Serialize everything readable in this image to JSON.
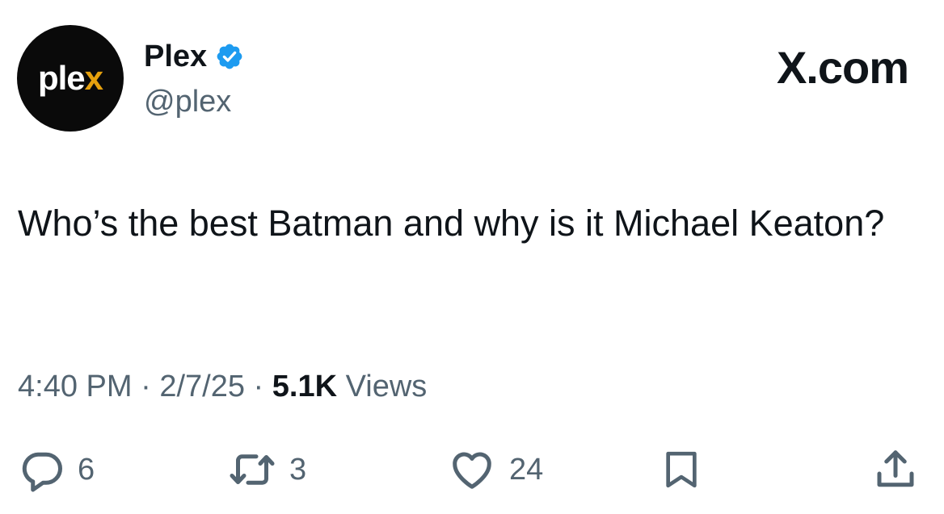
{
  "author": {
    "avatar_text_main": "ple",
    "avatar_text_accent": "x",
    "name": "Plex",
    "handle": "@plex",
    "verified": true
  },
  "brand": {
    "label": "X.com"
  },
  "tweet": {
    "text": "Who’s the best Batman and why is it Michael Keaton?"
  },
  "meta": {
    "time": "4:40 PM",
    "separator": "·",
    "date": "2/7/25",
    "views_count": "5.1K",
    "views_label": "Views"
  },
  "actions": {
    "reply": {
      "icon": "reply-icon",
      "count": "6"
    },
    "retweet": {
      "icon": "retweet-icon",
      "count": "3"
    },
    "like": {
      "icon": "heart-icon",
      "count": "24"
    },
    "bookmark": {
      "icon": "bookmark-icon"
    },
    "share": {
      "icon": "share-icon"
    }
  },
  "colors": {
    "text": "#0f1419",
    "secondary": "#536471",
    "verified": "#1d9bf0",
    "plex_accent": "#e5a00d"
  }
}
